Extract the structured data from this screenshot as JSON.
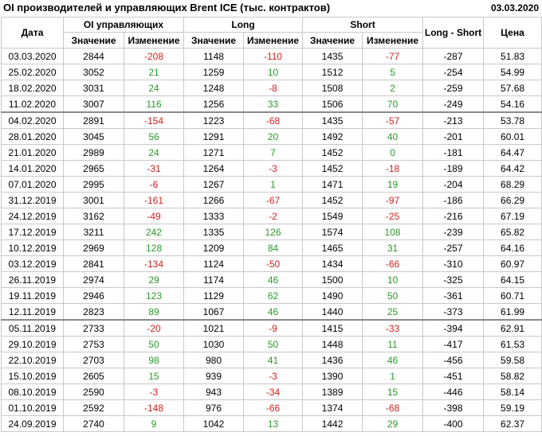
{
  "header": {
    "title": "OI производителей и управляющих Brent ICE (тыс. контрактов)",
    "date": "03.03.2020"
  },
  "columns": {
    "date": "Дата",
    "oi": "OI управляющих",
    "long": "Long",
    "short": "Short",
    "long_short": "Long - Short",
    "price": "Цена",
    "value": "Значение",
    "change": "Изменение"
  },
  "rows": [
    {
      "date": "03.03.2020",
      "oi": "2844",
      "oi_chg": "-208",
      "long": "1148",
      "long_chg": "-110",
      "short": "1435",
      "short_chg": "-77",
      "ls": "-287",
      "price": "51.83"
    },
    {
      "date": "25.02.2020",
      "oi": "3052",
      "oi_chg": "21",
      "long": "1259",
      "long_chg": "10",
      "short": "1512",
      "short_chg": "5",
      "ls": "-254",
      "price": "54.99"
    },
    {
      "date": "18.02.2020",
      "oi": "3031",
      "oi_chg": "24",
      "long": "1248",
      "long_chg": "-8",
      "short": "1508",
      "short_chg": "2",
      "ls": "-259",
      "price": "57.68"
    },
    {
      "date": "11.02.2020",
      "oi": "3007",
      "oi_chg": "116",
      "long": "1256",
      "long_chg": "33",
      "short": "1506",
      "short_chg": "70",
      "ls": "-249",
      "price": "54.16"
    },
    {
      "date": "04.02.2020",
      "oi": "2891",
      "oi_chg": "-154",
      "long": "1223",
      "long_chg": "-68",
      "short": "1435",
      "short_chg": "-57",
      "ls": "-213",
      "price": "53.78"
    },
    {
      "date": "28.01.2020",
      "oi": "3045",
      "oi_chg": "56",
      "long": "1291",
      "long_chg": "20",
      "short": "1492",
      "short_chg": "40",
      "ls": "-201",
      "price": "60.01"
    },
    {
      "date": "21.01.2020",
      "oi": "2989",
      "oi_chg": "24",
      "long": "1271",
      "long_chg": "7",
      "short": "1452",
      "short_chg": "0",
      "ls": "-181",
      "price": "64.47"
    },
    {
      "date": "14.01.2020",
      "oi": "2965",
      "oi_chg": "-31",
      "long": "1264",
      "long_chg": "-3",
      "short": "1452",
      "short_chg": "-18",
      "ls": "-189",
      "price": "64.42"
    },
    {
      "date": "07.01.2020",
      "oi": "2995",
      "oi_chg": "-6",
      "long": "1267",
      "long_chg": "1",
      "short": "1471",
      "short_chg": "19",
      "ls": "-204",
      "price": "68.29"
    },
    {
      "date": "31.12.2019",
      "oi": "3001",
      "oi_chg": "-161",
      "long": "1266",
      "long_chg": "-67",
      "short": "1452",
      "short_chg": "-97",
      "ls": "-186",
      "price": "66.29"
    },
    {
      "date": "24.12.2019",
      "oi": "3162",
      "oi_chg": "-49",
      "long": "1333",
      "long_chg": "-2",
      "short": "1549",
      "short_chg": "-25",
      "ls": "-216",
      "price": "67.19"
    },
    {
      "date": "17.12.2019",
      "oi": "3211",
      "oi_chg": "242",
      "long": "1335",
      "long_chg": "126",
      "short": "1574",
      "short_chg": "108",
      "ls": "-239",
      "price": "65.82"
    },
    {
      "date": "10.12.2019",
      "oi": "2969",
      "oi_chg": "128",
      "long": "1209",
      "long_chg": "84",
      "short": "1465",
      "short_chg": "31",
      "ls": "-257",
      "price": "64.16"
    },
    {
      "date": "03.12.2019",
      "oi": "2841",
      "oi_chg": "-134",
      "long": "1124",
      "long_chg": "-50",
      "short": "1434",
      "short_chg": "-66",
      "ls": "-310",
      "price": "60.97"
    },
    {
      "date": "26.11.2019",
      "oi": "2974",
      "oi_chg": "29",
      "long": "1174",
      "long_chg": "46",
      "short": "1500",
      "short_chg": "10",
      "ls": "-325",
      "price": "64.15"
    },
    {
      "date": "19.11.2019",
      "oi": "2946",
      "oi_chg": "123",
      "long": "1129",
      "long_chg": "62",
      "short": "1490",
      "short_chg": "50",
      "ls": "-361",
      "price": "60.71"
    },
    {
      "date": "12.11.2019",
      "oi": "2823",
      "oi_chg": "89",
      "long": "1067",
      "long_chg": "46",
      "short": "1440",
      "short_chg": "25",
      "ls": "-373",
      "price": "61.99"
    },
    {
      "date": "05.11.2019",
      "oi": "2733",
      "oi_chg": "-20",
      "long": "1021",
      "long_chg": "-9",
      "short": "1415",
      "short_chg": "-33",
      "ls": "-394",
      "price": "62.91"
    },
    {
      "date": "29.10.2019",
      "oi": "2753",
      "oi_chg": "50",
      "long": "1030",
      "long_chg": "50",
      "short": "1448",
      "short_chg": "11",
      "ls": "-417",
      "price": "61.53"
    },
    {
      "date": "22.10.2019",
      "oi": "2703",
      "oi_chg": "98",
      "long": "980",
      "long_chg": "41",
      "short": "1436",
      "short_chg": "46",
      "ls": "-456",
      "price": "59.58"
    },
    {
      "date": "15.10.2019",
      "oi": "2605",
      "oi_chg": "15",
      "long": "939",
      "long_chg": "-3",
      "short": "1390",
      "short_chg": "1",
      "ls": "-451",
      "price": "58.82"
    },
    {
      "date": "08.10.2019",
      "oi": "2590",
      "oi_chg": "-3",
      "long": "943",
      "long_chg": "-34",
      "short": "1389",
      "short_chg": "15",
      "ls": "-446",
      "price": "58.14"
    },
    {
      "date": "01.10.2019",
      "oi": "2592",
      "oi_chg": "-148",
      "long": "976",
      "long_chg": "-66",
      "short": "1374",
      "short_chg": "-68",
      "ls": "-398",
      "price": "59.19"
    },
    {
      "date": "24.09.2019",
      "oi": "2740",
      "oi_chg": "9",
      "long": "1042",
      "long_chg": "13",
      "short": "1442",
      "short_chg": "29",
      "ls": "-400",
      "price": "62.37"
    }
  ],
  "separator_before_rows": [
    4,
    17
  ],
  "colors": {
    "positive": "#2a9a2a",
    "negative": "#d42020",
    "border": "#c8c8c8",
    "separator": "#8a8a8a"
  }
}
